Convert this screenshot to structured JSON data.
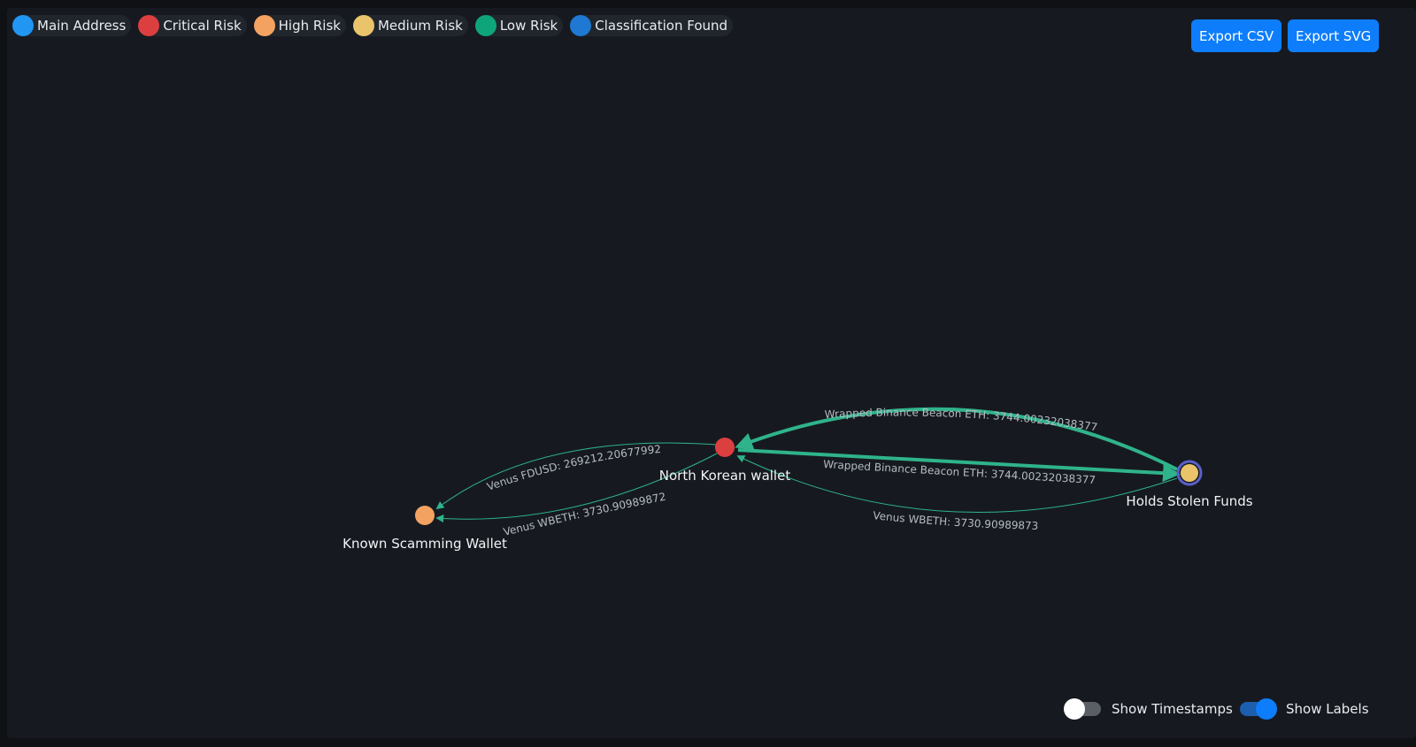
{
  "legend": [
    {
      "label": "Main Address",
      "color": "#2196f3"
    },
    {
      "label": "Critical Risk",
      "color": "#dc3f3f"
    },
    {
      "label": "High Risk",
      "color": "#f4a261"
    },
    {
      "label": "Medium Risk",
      "color": "#e9c46a"
    },
    {
      "label": "Low Risk",
      "color": "#0ea57a"
    },
    {
      "label": "Classification Found",
      "color": "#1f78d1"
    }
  ],
  "toolbar": {
    "export_csv_label": "Export CSV",
    "export_svg_label": "Export SVG"
  },
  "graph": {
    "nodes": [
      {
        "id": "nk",
        "label": "North Korean wallet",
        "risk": "Critical Risk",
        "color": "#dc3f3f"
      },
      {
        "id": "sc",
        "label": "Known Scamming Wallet",
        "risk": "High Risk",
        "color": "#f4a261"
      },
      {
        "id": "hs",
        "label": "Holds Stolen Funds",
        "risk": "Medium Risk",
        "color": "#e9c46a",
        "ring_color": "#5b5fc7"
      }
    ],
    "edges": [
      {
        "from": "hs",
        "to": "nk",
        "label": "Wrapped Binance Beacon ETH: 3744.002320383779",
        "color": "#2fb38a"
      },
      {
        "from": "nk",
        "to": "hs",
        "label": "Wrapped Binance Beacon ETH: 3744.002320383779",
        "color": "#2fb38a"
      },
      {
        "from": "hs",
        "to": "nk",
        "label": "Venus WBETH: 3730.90989873",
        "color": "#2fb38a"
      },
      {
        "from": "nk",
        "to": "sc",
        "label": "Venus FDUSD: 269212.20677992",
        "color": "#2fb38a"
      },
      {
        "from": "nk",
        "to": "sc",
        "label": "Venus WBETH: 3730.90989872",
        "color": "#2fb38a"
      }
    ]
  },
  "controls": {
    "show_timestamps": {
      "label": "Show Timestamps",
      "on": false
    },
    "show_labels": {
      "label": "Show Labels",
      "on": true
    }
  },
  "colors": {
    "accent": "#0d7dfb",
    "background": "#161a20",
    "edge": "#2fb38a"
  }
}
